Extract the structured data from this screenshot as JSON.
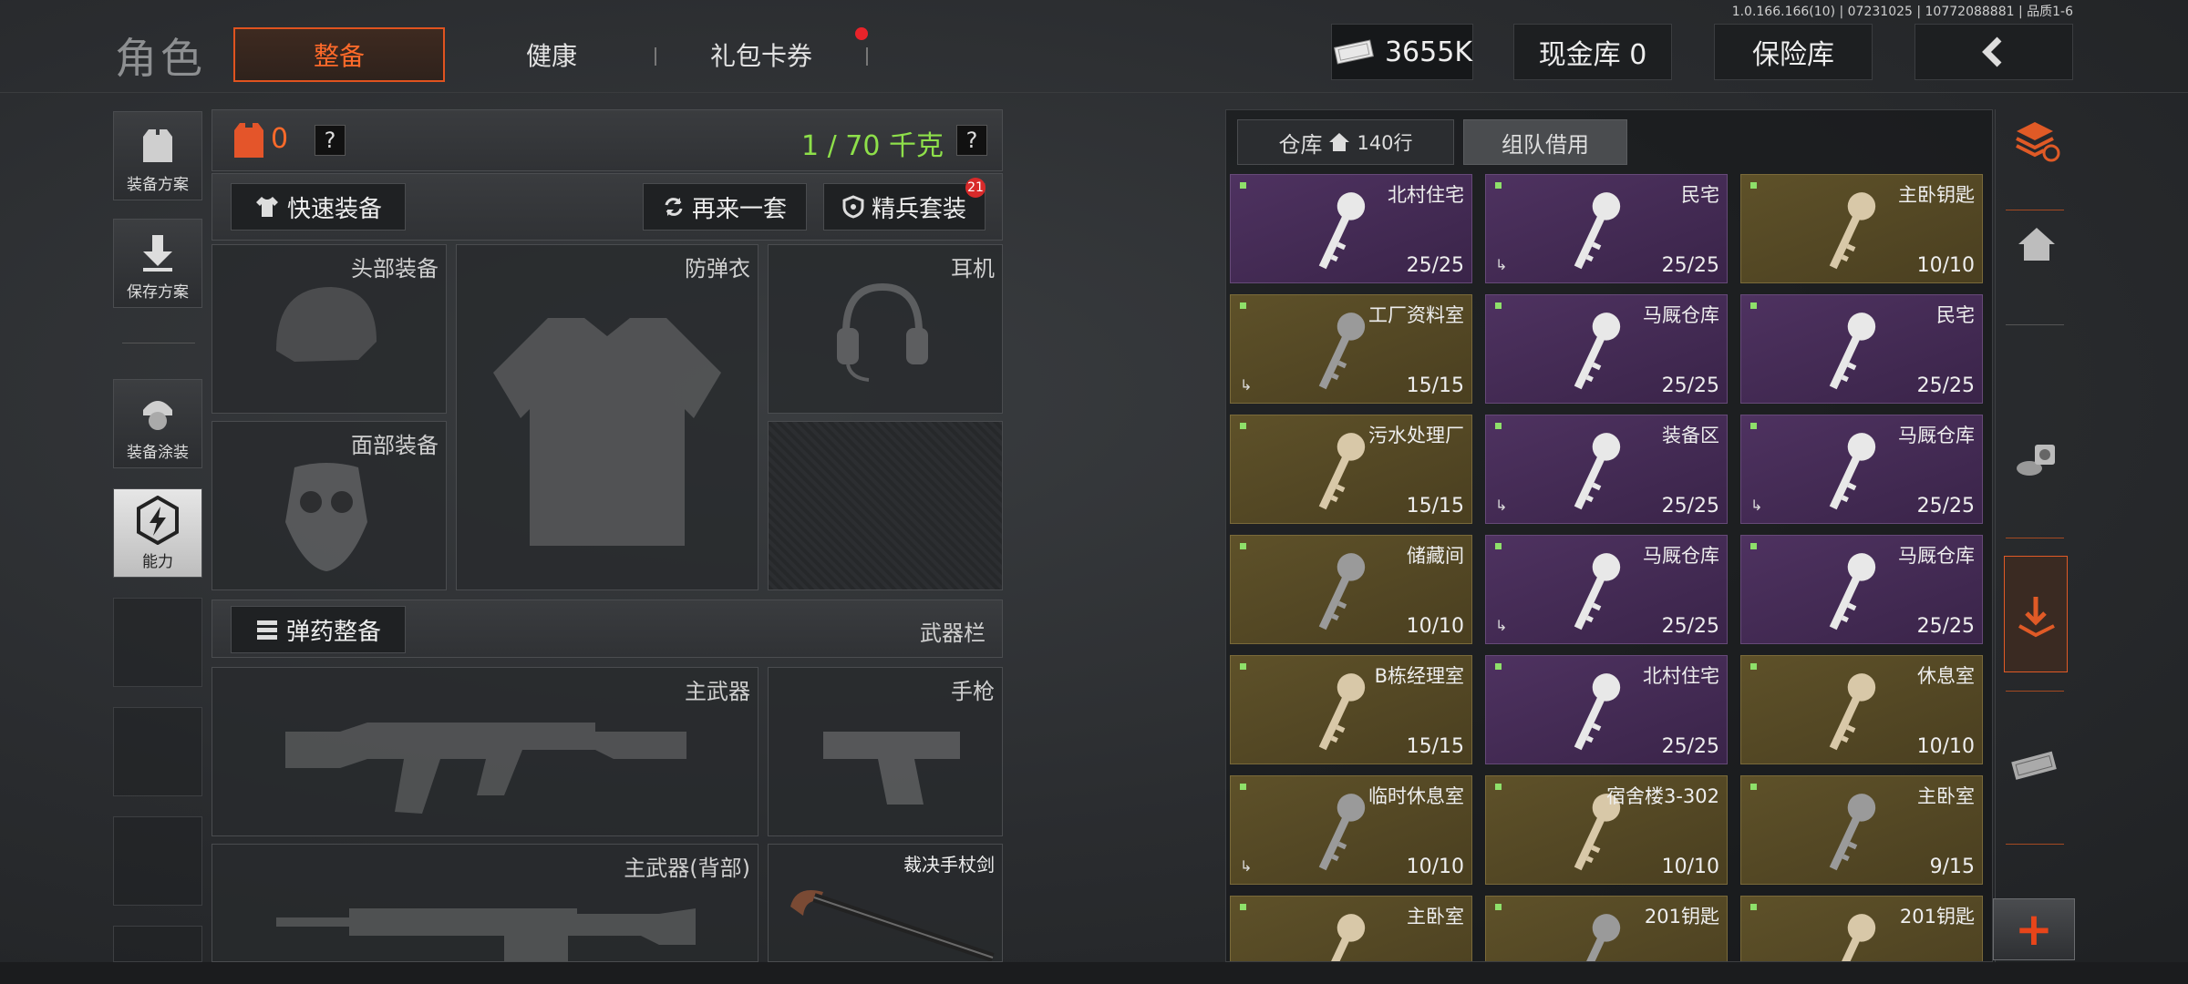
{
  "version": "1.0.166.166(10) | 07231025 | 10772088881 | 品质1-6",
  "page_title": "角色",
  "tabs": [
    {
      "label": "整备",
      "active": true
    },
    {
      "label": "健康",
      "active": false
    },
    {
      "label": "礼包卡券",
      "active": false
    }
  ],
  "header": {
    "money": "3655K",
    "cash_vault": "现金库 0",
    "safe": "保险库"
  },
  "sidebar": {
    "items": [
      {
        "label": "装备方案"
      },
      {
        "label": "保存方案"
      },
      {
        "label": "装备涂装"
      },
      {
        "label": "能力"
      }
    ]
  },
  "loadout": {
    "armor_count": "0",
    "weight": "1 / 70 千克",
    "quick_equip": "快速装备",
    "again": "再来一套",
    "elite_set": "精兵套装",
    "elite_badge": "21",
    "ammo_equip": "弹药整备",
    "weapon_bar": "武器栏",
    "slots": {
      "head": "头部装备",
      "vest": "防弹衣",
      "headset": "耳机",
      "face": "面部装备",
      "primary": "主武器",
      "pistol": "手枪",
      "primary_back": "主武器(背部)",
      "melee": "裁决手杖剑"
    }
  },
  "warehouse": {
    "tab_label": "仓库",
    "tab_rows": "140行",
    "team_borrow": "组队借用",
    "items": [
      {
        "name": "北村住宅",
        "count": "25/25",
        "color": "purple",
        "exit": false
      },
      {
        "name": "民宅",
        "count": "25/25",
        "color": "purple",
        "exit": true
      },
      {
        "name": "主卧钥匙",
        "count": "10/10",
        "color": "gold",
        "exit": false
      },
      {
        "name": "工厂资料室",
        "count": "15/15",
        "color": "gold",
        "exit": true
      },
      {
        "name": "马厩仓库",
        "count": "25/25",
        "color": "purple",
        "exit": false
      },
      {
        "name": "民宅",
        "count": "25/25",
        "color": "purple",
        "exit": false
      },
      {
        "name": "污水处理厂",
        "count": "15/15",
        "color": "gold",
        "exit": false
      },
      {
        "name": "装备区",
        "count": "25/25",
        "color": "purple",
        "exit": true
      },
      {
        "name": "马厩仓库",
        "count": "25/25",
        "color": "purple",
        "exit": true
      },
      {
        "name": "储藏间",
        "count": "10/10",
        "color": "gold",
        "exit": false
      },
      {
        "name": "马厩仓库",
        "count": "25/25",
        "color": "purple",
        "exit": true
      },
      {
        "name": "马厩仓库",
        "count": "25/25",
        "color": "purple",
        "exit": false
      },
      {
        "name": "B栋经理室",
        "count": "15/15",
        "color": "gold",
        "exit": false
      },
      {
        "name": "北村住宅",
        "count": "25/25",
        "color": "purple",
        "exit": false
      },
      {
        "name": "休息室",
        "count": "10/10",
        "color": "gold",
        "exit": false
      },
      {
        "name": "临时休息室",
        "count": "10/10",
        "color": "gold",
        "exit": true
      },
      {
        "name": "宿舍楼3-302",
        "count": "10/10",
        "color": "gold",
        "exit": false
      },
      {
        "name": "主卧室",
        "count": "9/15",
        "color": "gold",
        "exit": false
      },
      {
        "name": "主卧室",
        "count": "",
        "color": "gold",
        "exit": false
      },
      {
        "name": "201钥匙",
        "count": "",
        "color": "gold",
        "exit": false
      },
      {
        "name": "201钥匙",
        "count": "",
        "color": "gold",
        "exit": false
      }
    ]
  },
  "plus_label": "+"
}
